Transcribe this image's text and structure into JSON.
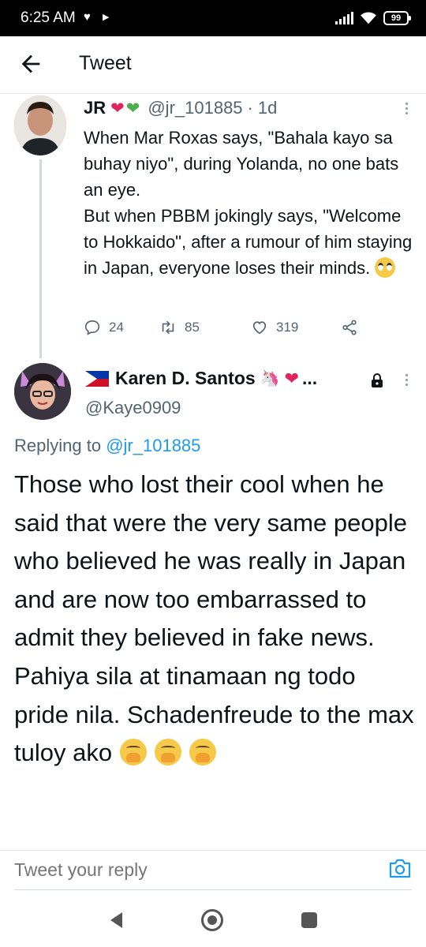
{
  "status_bar": {
    "time": "6:25 AM",
    "battery": "99"
  },
  "header": {
    "title": "Tweet"
  },
  "tweet": {
    "name": "JR",
    "handle": "@jr_101885",
    "separator": "·",
    "time_ago": "1d",
    "body_lines": [
      "When Mar Roxas says, \"Bahala kayo sa buhay niyo\", during Yolanda, no one bats an eye.",
      "But when PBBM jokingly says, \"Welcome to Hokkaido\", after a rumour of him staying in Japan, everyone loses their minds."
    ],
    "replies": "24",
    "retweets": "85",
    "likes": "319"
  },
  "reply": {
    "name": "Karen D. Santos",
    "ellipsis": "...",
    "handle": "@Kaye0909",
    "replying_to_label": "Replying to",
    "replying_to_handle": "@jr_101885",
    "body": "Those who lost their cool when he said that were the very same people who believed he was really in Japan and are now too embarrassed to admit they believed in fake news. Pahiya sila at tinamaan ng todo pride nila. Schadenfreude to the max tuloy ako"
  },
  "compose": {
    "placeholder": "Tweet your reply"
  },
  "icons": {
    "back": "arrow-left-icon",
    "reply": "comment-icon",
    "retweet": "retweet-icon",
    "like": "heart-outline-icon",
    "share": "share-icon",
    "lock": "lock-icon",
    "camera": "camera-icon"
  },
  "colors": {
    "link": "#1d9bf0",
    "secondary_text": "#536471",
    "primary_text": "#0f1419"
  }
}
